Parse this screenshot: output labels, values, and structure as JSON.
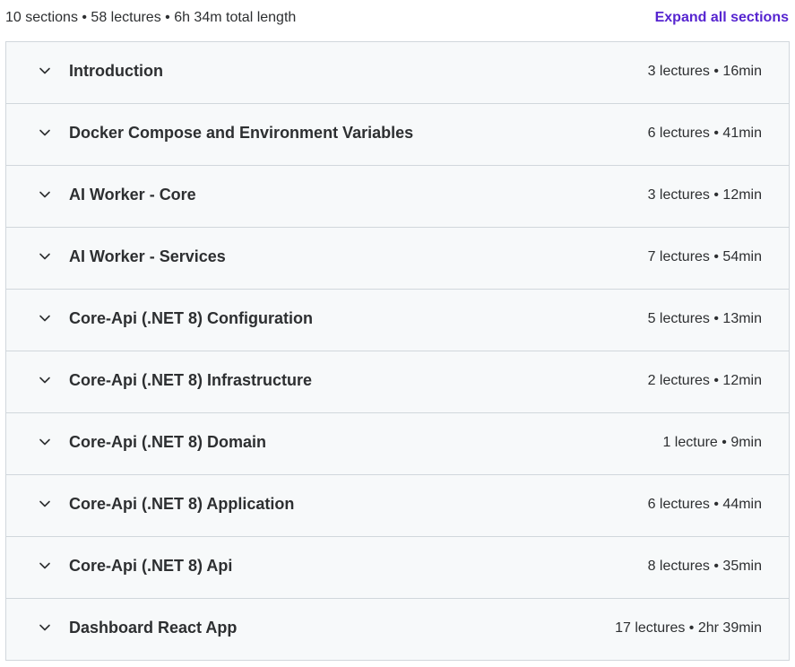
{
  "summary": "10 sections • 58 lectures • 6h 34m total length",
  "expand_all_label": "Expand all sections",
  "colors": {
    "accent": "#5624d0",
    "row_background": "#f7f9fa",
    "border": "#d1d7dc",
    "text": "#2d2f31"
  },
  "sections": [
    {
      "title": "Introduction",
      "meta": "3 lectures • 16min",
      "icon": "chevron-down-icon"
    },
    {
      "title": "Docker Compose and Environment Variables",
      "meta": "6 lectures • 41min",
      "icon": "chevron-down-icon"
    },
    {
      "title": "AI Worker - Core",
      "meta": "3 lectures • 12min",
      "icon": "chevron-down-icon"
    },
    {
      "title": "AI Worker - Services",
      "meta": "7 lectures • 54min",
      "icon": "chevron-down-icon"
    },
    {
      "title": "Core-Api (.NET 8) Configuration",
      "meta": "5 lectures • 13min",
      "icon": "chevron-down-icon"
    },
    {
      "title": "Core-Api (.NET 8) Infrastructure",
      "meta": "2 lectures • 12min",
      "icon": "chevron-down-icon"
    },
    {
      "title": "Core-Api (.NET 8) Domain",
      "meta": "1 lecture • 9min",
      "icon": "chevron-down-icon"
    },
    {
      "title": "Core-Api (.NET 8) Application",
      "meta": "6 lectures • 44min",
      "icon": "chevron-down-icon"
    },
    {
      "title": "Core-Api (.NET 8) Api",
      "meta": "8 lectures • 35min",
      "icon": "chevron-down-icon"
    },
    {
      "title": "Dashboard React App",
      "meta": "17 lectures • 2hr 39min",
      "icon": "chevron-down-icon"
    }
  ]
}
